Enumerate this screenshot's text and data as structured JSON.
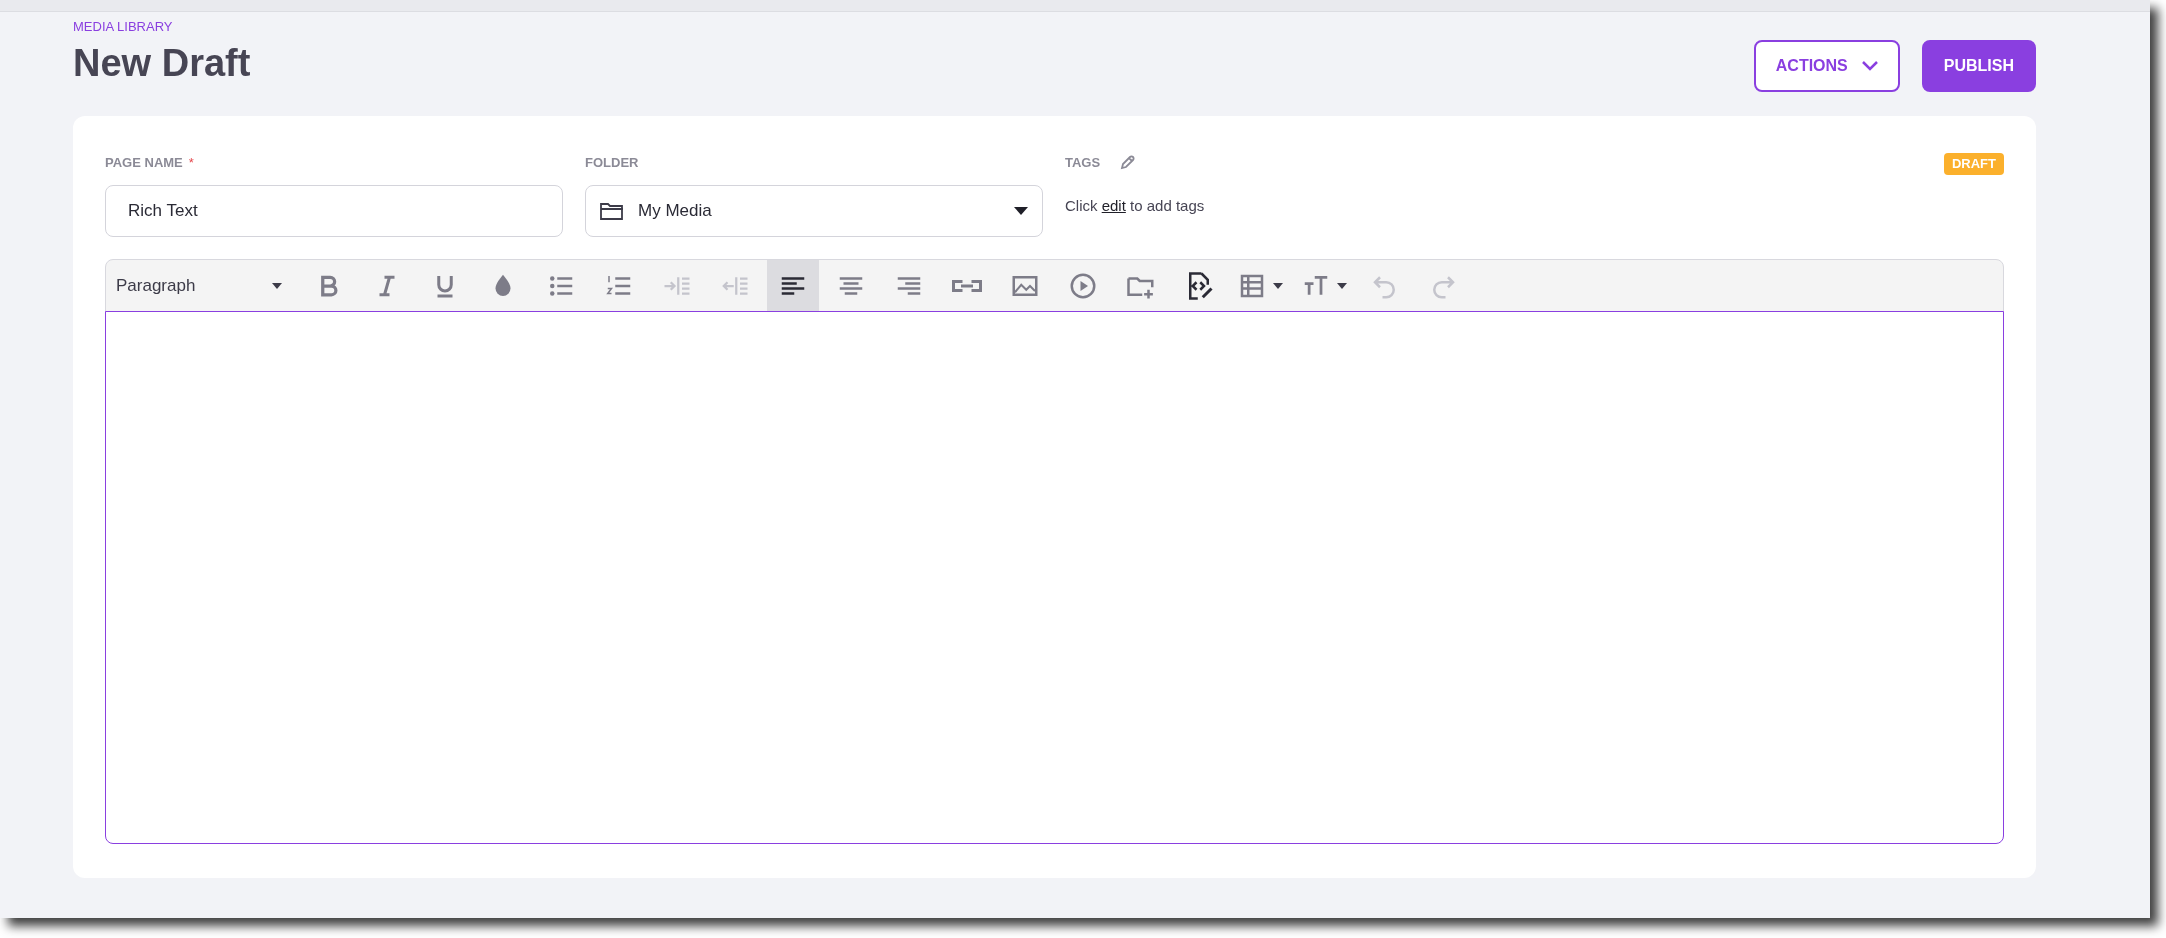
{
  "breadcrumb": "MEDIA LIBRARY",
  "title": "New Draft",
  "header_buttons": [
    {
      "label": "ACTIONS",
      "kind": "dropdown"
    },
    {
      "label": "PUBLISH",
      "kind": "primary"
    }
  ],
  "form": {
    "page_name": {
      "label": "PAGE NAME",
      "required_mark": "*",
      "value": "Rich Text"
    },
    "folder": {
      "label": "FOLDER",
      "value": "My Media"
    },
    "tags": {
      "label": "TAGS",
      "hint": "Click **edit** to add tags"
    },
    "status_badge": "DRAFT"
  },
  "editor": {
    "block_format": "Paragraph",
    "toolbar": [
      {
        "kind": "bold",
        "selected": false,
        "disabled": false
      },
      {
        "kind": "italic",
        "selected": false,
        "disabled": false
      },
      {
        "kind": "underline",
        "selected": false,
        "disabled": false
      },
      {
        "kind": "color",
        "selected": false,
        "disabled": false
      },
      {
        "kind": "bullets",
        "selected": false,
        "disabled": false
      },
      {
        "kind": "numbers",
        "selected": false,
        "disabled": false
      },
      {
        "kind": "indent",
        "selected": false,
        "disabled": true
      },
      {
        "kind": "outdent",
        "selected": false,
        "disabled": true
      },
      {
        "kind": "align-left",
        "selected": true,
        "disabled": false
      },
      {
        "kind": "align-center",
        "selected": false,
        "disabled": false
      },
      {
        "kind": "align-right",
        "selected": false,
        "disabled": false
      },
      {
        "kind": "link",
        "selected": false,
        "disabled": false
      },
      {
        "kind": "image",
        "selected": false,
        "disabled": false
      },
      {
        "kind": "video",
        "selected": false,
        "disabled": false
      },
      {
        "kind": "folder-add",
        "selected": false,
        "disabled": false
      },
      {
        "kind": "code",
        "selected": false,
        "disabled": false
      },
      {
        "kind": "table",
        "selected": false,
        "disabled": false
      },
      {
        "kind": "text-size",
        "selected": false,
        "disabled": false
      },
      {
        "kind": "undo",
        "selected": false,
        "disabled": true
      },
      {
        "kind": "redo",
        "selected": false,
        "disabled": true
      }
    ]
  }
}
